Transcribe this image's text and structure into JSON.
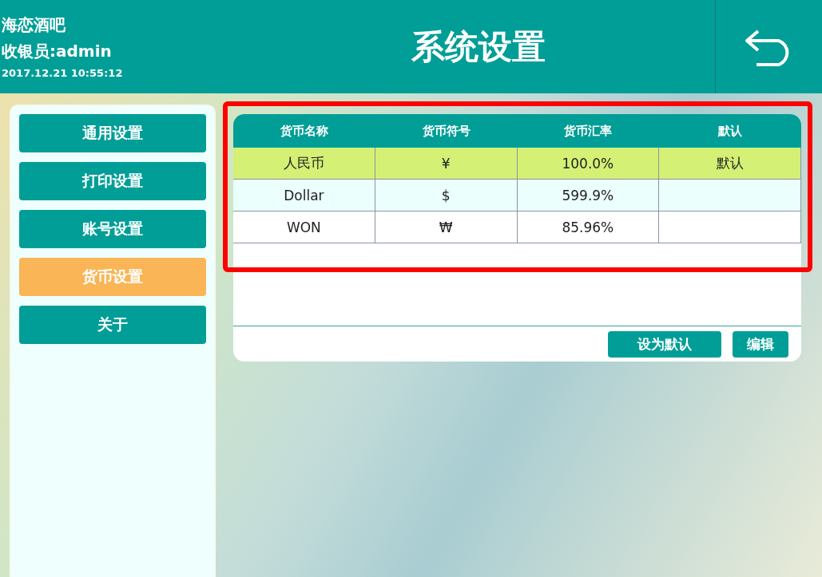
{
  "header": {
    "store": "海恋酒吧",
    "cashier": "收银员:admin",
    "datetime": "2017.12.21 10:55:12",
    "title": "系统设置"
  },
  "sidebar": {
    "items": [
      {
        "label": "通用设置",
        "selected": false
      },
      {
        "label": "打印设置",
        "selected": false
      },
      {
        "label": "账号设置",
        "selected": false
      },
      {
        "label": "货币设置",
        "selected": true
      },
      {
        "label": "关于",
        "selected": false
      }
    ]
  },
  "table": {
    "columns": [
      "货币名称",
      "货币符号",
      "货币汇率",
      "默认"
    ],
    "rows": [
      {
        "selected": true,
        "cells": [
          "人民币",
          "¥",
          "100.0%",
          "默认"
        ]
      },
      {
        "selected": false,
        "cells": [
          "Dollar",
          "$",
          "599.9%",
          null
        ]
      },
      {
        "selected": false,
        "cells": [
          "WON",
          "₩",
          "85.96%",
          null
        ]
      }
    ]
  },
  "buttons": [
    "设为默认",
    "编辑"
  ],
  "highlight": true
}
